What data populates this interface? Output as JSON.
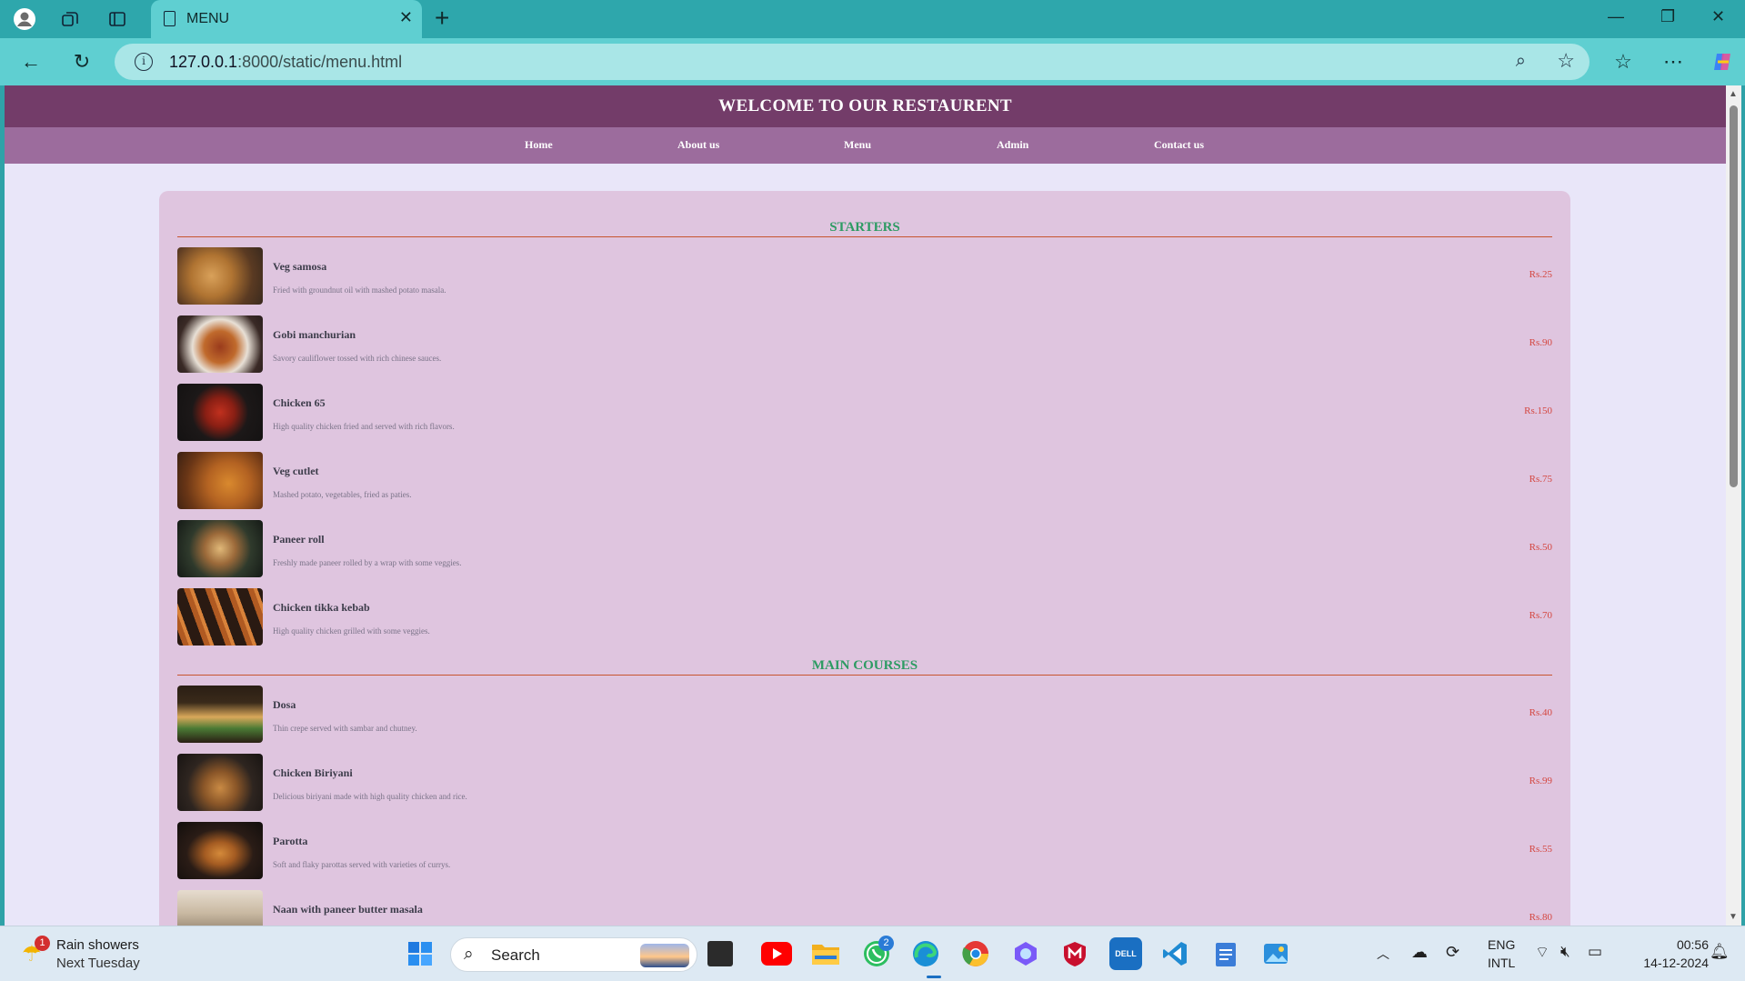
{
  "browser": {
    "tab_title": "MENU",
    "url_host": "127.0.0.1",
    "url_path": ":8000/static/menu.html"
  },
  "site": {
    "heading": "WELCOME TO OUR RESTAURENT",
    "nav": [
      "Home",
      "About us",
      "Menu",
      "Admin",
      "Contact us"
    ]
  },
  "menu": {
    "sections": [
      {
        "title": "STARTERS",
        "items": [
          {
            "name": "Veg samosa",
            "desc": "Fried with groundnut oil with mashed potato masala.",
            "price": "Rs.25"
          },
          {
            "name": "Gobi manchurian",
            "desc": "Savory cauliflower tossed with rich chinese sauces.",
            "price": "Rs.90"
          },
          {
            "name": "Chicken 65",
            "desc": "High quality chicken fried and served with rich flavors.",
            "price": "Rs.150"
          },
          {
            "name": "Veg cutlet",
            "desc": "Mashed potato, vegetables, fried as paties.",
            "price": "Rs.75"
          },
          {
            "name": "Paneer roll",
            "desc": "Freshly made paneer rolled by a wrap with some veggies.",
            "price": "Rs.50"
          },
          {
            "name": "Chicken tikka kebab",
            "desc": "High quality chicken grilled with some veggies.",
            "price": "Rs.70"
          }
        ]
      },
      {
        "title": "MAIN COURSES",
        "items": [
          {
            "name": "Dosa",
            "desc": "Thin crepe served with sambar and chutney.",
            "price": "Rs.40"
          },
          {
            "name": "Chicken Biriyani",
            "desc": "Delicious biriyani made with high quality chicken and rice.",
            "price": "Rs.99"
          },
          {
            "name": "Parotta",
            "desc": "Soft and flaky parottas served with varieties of currys.",
            "price": "Rs.55"
          },
          {
            "name": "Naan with paneer butter masala",
            "desc": "",
            "price": "Rs.80"
          }
        ]
      }
    ]
  },
  "taskbar": {
    "weather_line1": "Rain showers",
    "weather_line2": "Next Tuesday",
    "weather_badge": "1",
    "search_label": "Search",
    "whatsapp_badge": "2",
    "lang_line1": "ENG",
    "lang_line2": "INTL",
    "time": "00:56",
    "date": "14-12-2024"
  },
  "colors": {
    "header": "#733c69",
    "nav": "#9c6c9d",
    "card": "#dfc5df",
    "section_title": "#2d9b63",
    "price": "#d4463f"
  }
}
